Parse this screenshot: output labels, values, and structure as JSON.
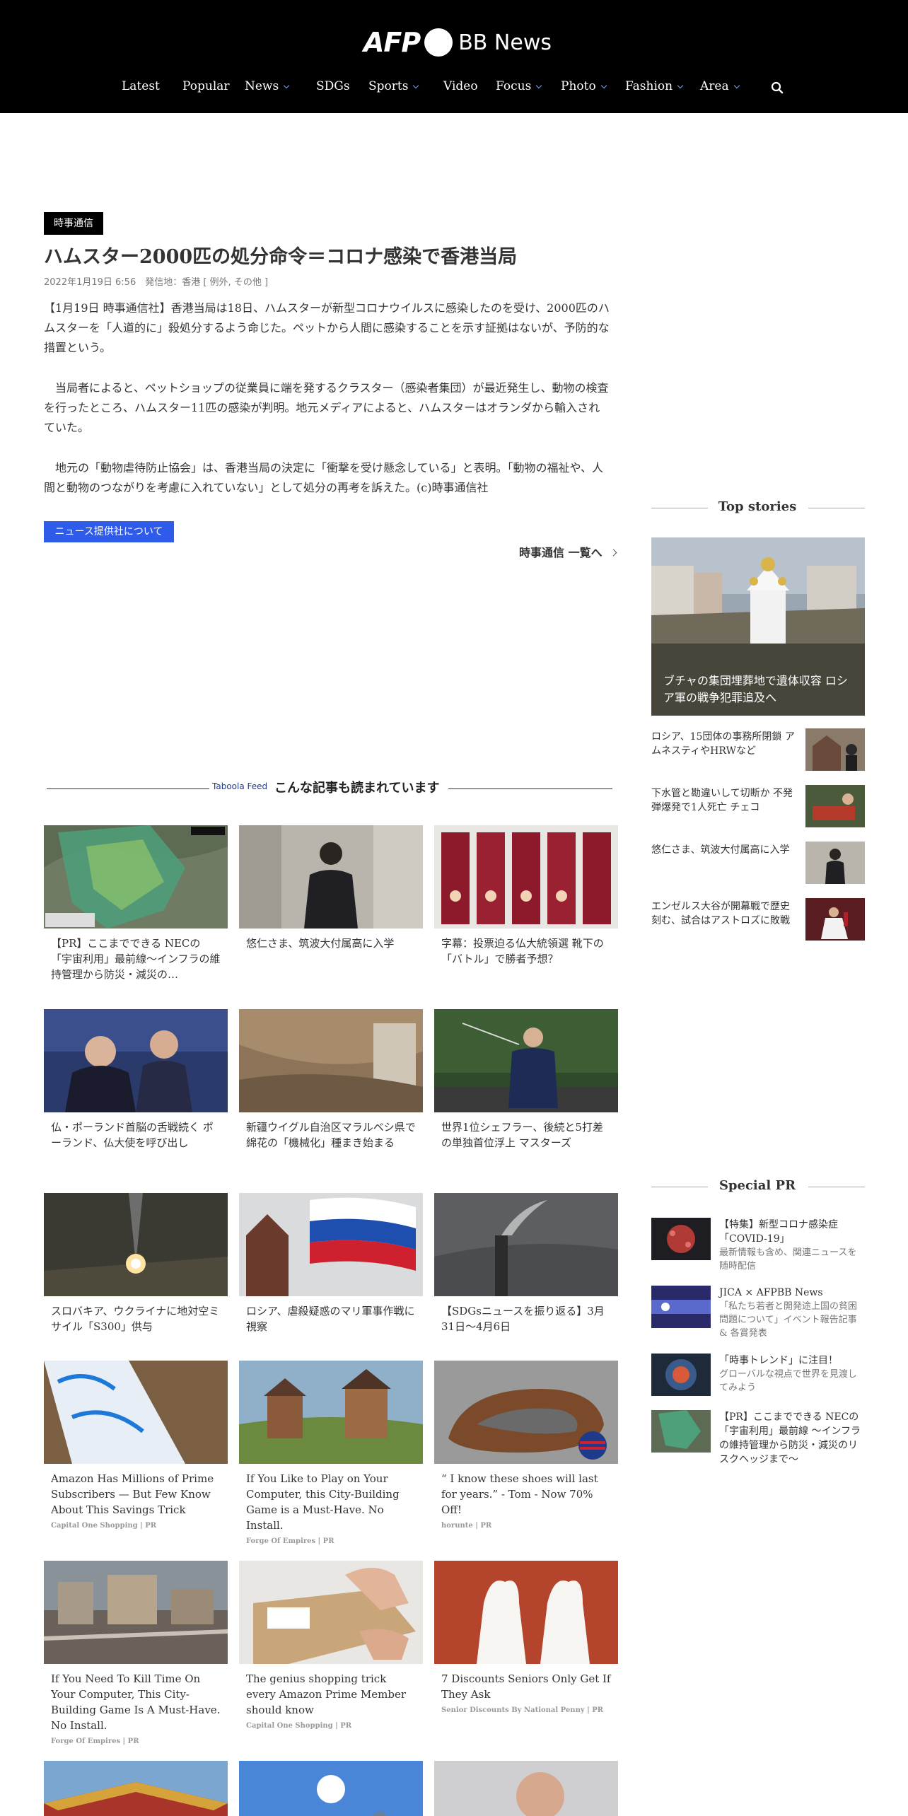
{
  "brand": {
    "afp": "AFP",
    "bb": "BB News"
  },
  "nav": [
    {
      "label": "Latest",
      "dropdown": false
    },
    {
      "label": "Popular",
      "dropdown": false
    },
    {
      "label": "News",
      "dropdown": true
    },
    {
      "label": "SDGs",
      "dropdown": false
    },
    {
      "label": "Sports",
      "dropdown": true
    },
    {
      "label": "Video",
      "dropdown": false
    },
    {
      "label": "Focus",
      "dropdown": true
    },
    {
      "label": "Photo",
      "dropdown": true
    },
    {
      "label": "Fashion",
      "dropdown": true
    },
    {
      "label": "Area",
      "dropdown": true
    }
  ],
  "article": {
    "source_badge": "時事通信",
    "headline": "ハムスター2000匹の処分命令＝コロナ感染で香港当局",
    "dateline": "2022年1月19日 6:56　発信地：香港 [ 例外, その他 ]",
    "paragraphs": [
      "【1月19日 時事通信社】香港当局は18日、ハムスターが新型コロナウイルスに感染したのを受け、2000匹のハムスターを「人道的に」殺処分するよう命じた。ペットから人間に感染することを示す証拠はないが、予防的な措置という。",
      "　当局者によると、ペットショップの従業員に端を発するクラスター（感染者集団）が最近発生し、動物の検査を行ったところ、ハムスター11匹の感染が判明。地元メディアによると、ハムスターはオランダから輸入されていた。",
      "　地元の「動物虐待防止協会」は、香港当局の決定に「衝撃を受け懸念している」と表明。「動物の福祉や、人間と動物のつながりを考慮に入れていない」として処分の再考を訴えた。(c)時事通信社"
    ],
    "about_button": "ニュース提供社について",
    "more_link": "時事通信 一覧へ"
  },
  "taboola": {
    "brand": "Taboola Feed",
    "title": "こんな記事も読まれています",
    "cards": [
      {
        "title": "【PR】ここまでできる NECの「宇宙利用」最前線～インフラの維持管理から防災・減災の…",
        "source": ""
      },
      {
        "title": "悠仁さま、筑波大付属高に入学",
        "source": ""
      },
      {
        "title": "字幕：投票迫る仏大統領選 靴下の「バトル」で勝者予想？",
        "source": ""
      },
      {
        "title": "仏・ポーランド首脳の舌戦続く ポーランド、仏大使を呼び出し",
        "source": ""
      },
      {
        "title": "新疆ウイグル自治区マラルベシ県で綿花の「機械化」種まき始まる",
        "source": ""
      },
      {
        "title": "世界1位シェフラー、後続と5打差の単独首位浮上 マスターズ",
        "source": ""
      },
      {
        "title": "スロバキア、ウクライナに地対空ミサイル「S300」供与",
        "source": ""
      },
      {
        "title": "ロシア、虐殺疑惑のマリ軍事作戦に視察",
        "source": ""
      },
      {
        "title": "【SDGsニュースを振り返る】3月31日〜4月6日",
        "source": ""
      },
      {
        "title": "Amazon Has Millions of Prime Subscribers — But Few Know About This Savings Trick",
        "source": "Capital One Shopping | PR"
      },
      {
        "title": "If You Like to Play on Your Computer, this City-Building Game is a Must-Have. No Install.",
        "source": "Forge Of Empires | PR"
      },
      {
        "title": "“ I know these shoes will last for years.” - Tom - Now 70% Off!",
        "source": "horunte | PR"
      },
      {
        "title": "If You Need To Kill Time On Your Computer, This City-Building Game Is A Must-Have. No Install.",
        "source": "Forge Of Empires | PR"
      },
      {
        "title": "The genius shopping trick every Amazon Prime Member should know",
        "source": "Capital One Shopping | PR"
      },
      {
        "title": "7 Discounts Seniors Only Get If They Ask",
        "source": "Senior Discounts By National Penny | PR"
      },
      {
        "title": "",
        "source": ""
      },
      {
        "title": "",
        "source": ""
      },
      {
        "title": "",
        "source": ""
      }
    ]
  },
  "sidebar": {
    "top_stories_title": "Top stories",
    "hero_caption": "ブチャの集団埋葬地で遺体収容 ロシア軍の戦争犯罪追及へ",
    "stories": [
      {
        "title": "ロシア、15団体の事務所閉鎖 アムネスティやHRWなど"
      },
      {
        "title": "下水管と勘違いして切断か 不発弾爆発で1人死亡 チェコ"
      },
      {
        "title": "悠仁さま、筑波大付属高に入学"
      },
      {
        "title": "エンゼルス大谷が開幕戦で歴史刻む、試合はアストロズに敗戦"
      }
    ],
    "special_pr_title": "Special PR",
    "pr_items": [
      {
        "title": "【特集】新型コロナ感染症「COVID-19」",
        "sub": "最新情報も含め、関連ニュースを随時配信"
      },
      {
        "title": "JICA × AFPBB News",
        "sub": "「私たち若者と開発途上国の貧困問題について」イベント報告記事 & 各賞発表"
      },
      {
        "title": "「時事トレンド」に注目！",
        "sub": "グローバルな視点で世界を見渡してみよう"
      },
      {
        "title": "【PR】ここまでできる NECの「宇宙利用」最前線 ～インフラの維持管理から防災・減災のリスクヘッジまで～",
        "sub": ""
      }
    ]
  }
}
